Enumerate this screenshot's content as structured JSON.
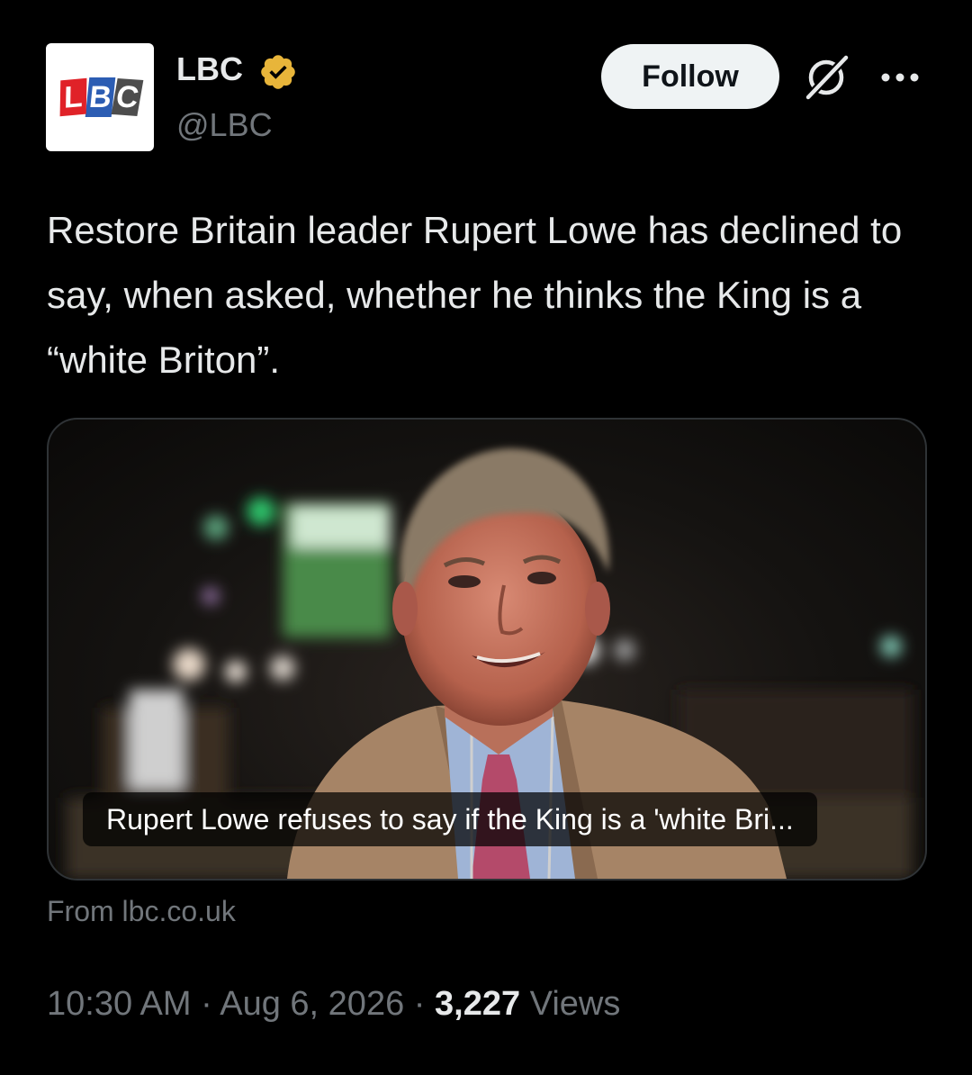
{
  "account": {
    "logo_letters": [
      "L",
      "B",
      "C"
    ],
    "name": "LBC",
    "handle": "@LBC",
    "verified": true,
    "verified_badge_color": "#e8b53a"
  },
  "actions": {
    "follow_label": "Follow"
  },
  "tweet": {
    "text": "Restore Britain leader Rupert Lowe has declined to say, when asked, whether he thinks the King is a “white Briton”."
  },
  "link_card": {
    "caption": "Rupert Lowe refuses to say if the King is a 'white Bri...",
    "source": "From lbc.co.uk"
  },
  "meta": {
    "time": "10:30 AM",
    "separator": "·",
    "date": "Aug 6, 2026",
    "views_count": "3,227",
    "views_label": "Views"
  },
  "colors": {
    "background": "#000000",
    "text_primary": "#e7e9ea",
    "text_secondary": "#71767b",
    "follow_button_bg": "#eff3f4"
  }
}
